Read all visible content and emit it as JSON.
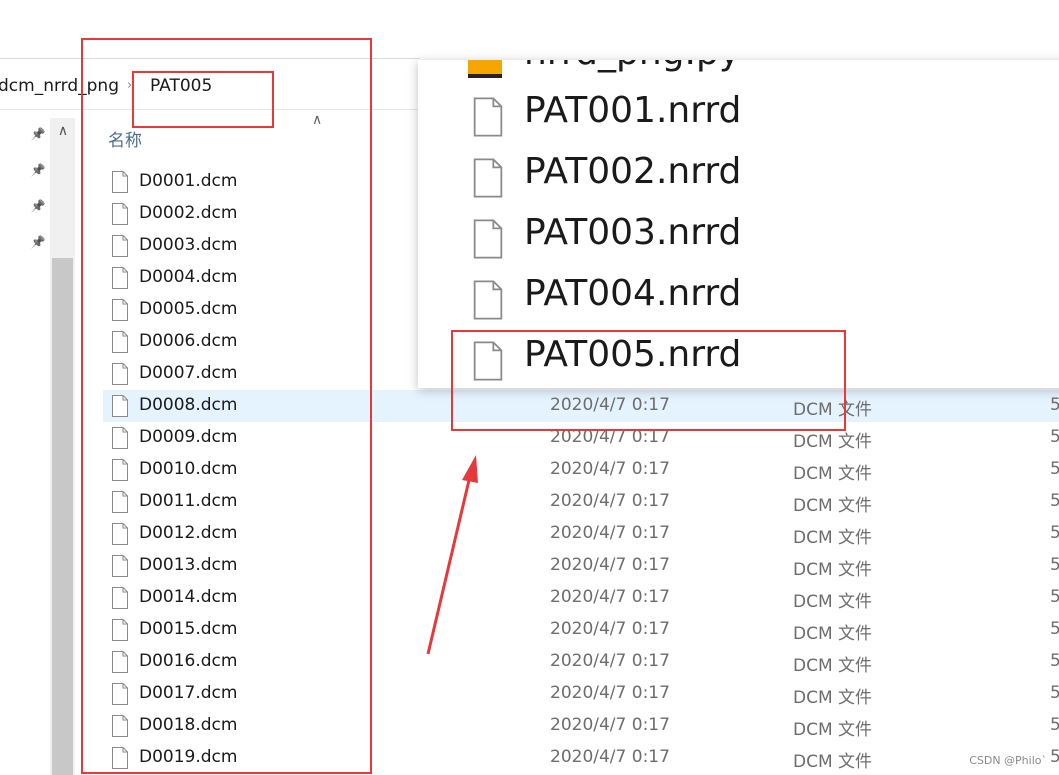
{
  "breadcrumb": {
    "parent": "dcm_nrrd_png",
    "separator": "›",
    "current": "PAT005"
  },
  "nav": {
    "pin_icons": [
      "pin-icon",
      "pin-icon",
      "pin-icon",
      "pin-icon"
    ],
    "scroll_up_glyph": "∧"
  },
  "list": {
    "name_header": "名称",
    "sort_glyph": "∧",
    "rows": [
      {
        "name": "D0001.dcm"
      },
      {
        "name": "D0002.dcm"
      },
      {
        "name": "D0003.dcm"
      },
      {
        "name": "D0004.dcm"
      },
      {
        "name": "D0005.dcm"
      },
      {
        "name": "D0006.dcm"
      },
      {
        "name": "D0007.dcm"
      },
      {
        "name": "D0008.dcm",
        "date": "2020/4/7 0:17",
        "type": "DCM 文件",
        "size": "5"
      },
      {
        "name": "D0009.dcm",
        "date": "2020/4/7 0:17",
        "type": "DCM 文件",
        "size": "5"
      },
      {
        "name": "D0010.dcm",
        "date": "2020/4/7 0:17",
        "type": "DCM 文件",
        "size": "5"
      },
      {
        "name": "D0011.dcm",
        "date": "2020/4/7 0:17",
        "type": "DCM 文件",
        "size": "5"
      },
      {
        "name": "D0012.dcm",
        "date": "2020/4/7 0:17",
        "type": "DCM 文件",
        "size": "5"
      },
      {
        "name": "D0013.dcm",
        "date": "2020/4/7 0:17",
        "type": "DCM 文件",
        "size": "5"
      },
      {
        "name": "D0014.dcm",
        "date": "2020/4/7 0:17",
        "type": "DCM 文件",
        "size": "5"
      },
      {
        "name": "D0015.dcm",
        "date": "2020/4/7 0:17",
        "type": "DCM 文件",
        "size": "5"
      },
      {
        "name": "D0016.dcm",
        "date": "2020/4/7 0:17",
        "type": "DCM 文件",
        "size": "5"
      },
      {
        "name": "D0017.dcm",
        "date": "2020/4/7 0:17",
        "type": "DCM 文件",
        "size": "5"
      },
      {
        "name": "D0018.dcm",
        "date": "2020/4/7 0:17",
        "type": "DCM 文件",
        "size": "5"
      },
      {
        "name": "D0019.dcm",
        "date": "2020/4/7 0:17",
        "type": "DCM 文件",
        "size": "5"
      }
    ]
  },
  "inset": {
    "partial_item": "nrrd_png.py",
    "items": [
      "PAT001.nrrd",
      "PAT002.nrrd",
      "PAT003.nrrd",
      "PAT004.nrrd",
      "PAT005.nrrd"
    ]
  },
  "watermark": "CSDN @Philo`",
  "colors": {
    "annotation_red": "#e5393b",
    "selection_blue": "#e5f3ff"
  }
}
